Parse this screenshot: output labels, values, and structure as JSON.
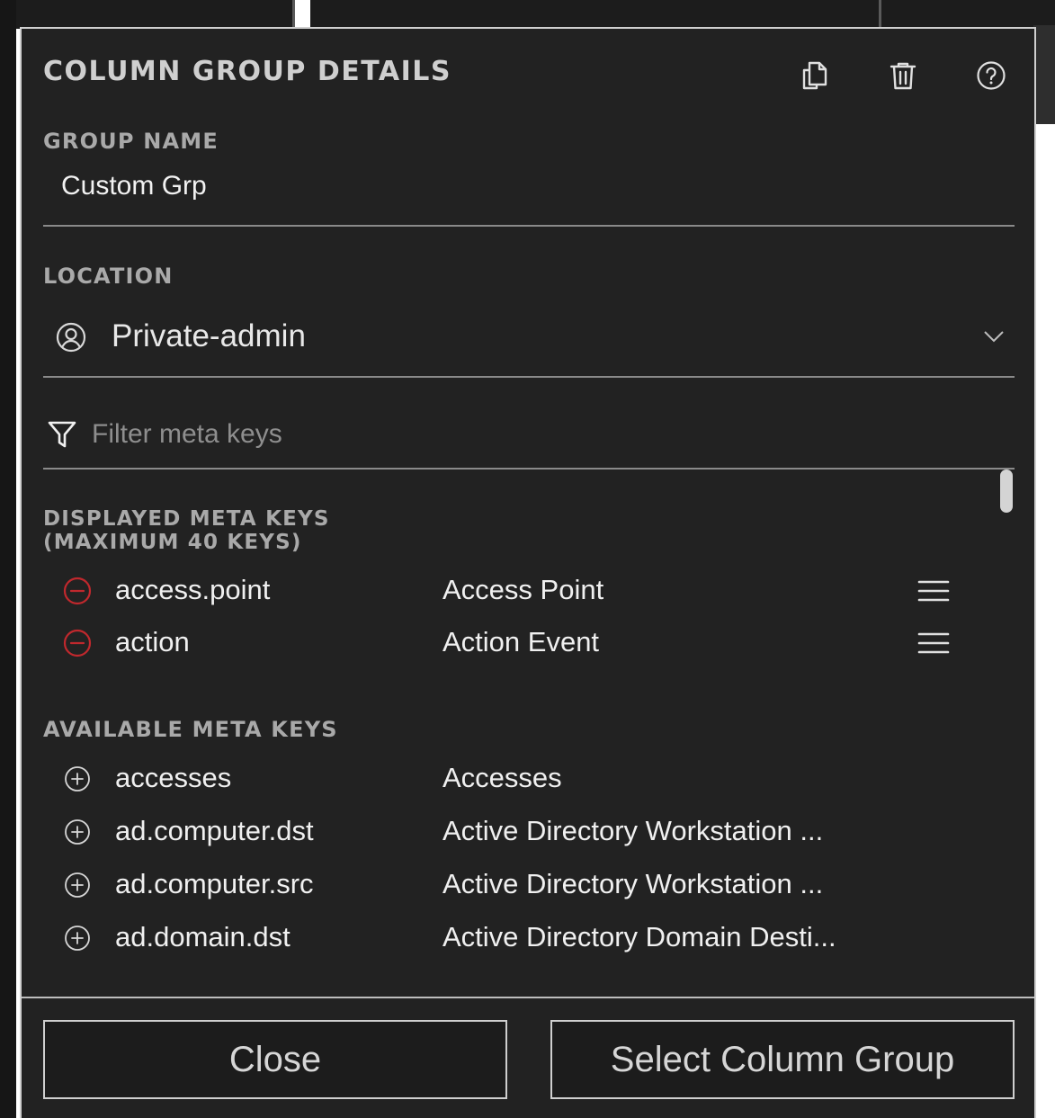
{
  "panel": {
    "title": "COLUMN GROUP DETAILS",
    "header_icons": [
      "copy-icon",
      "trash-icon",
      "help-icon"
    ]
  },
  "group_name": {
    "label": "GROUP NAME",
    "value": "Custom Grp"
  },
  "location": {
    "label": "LOCATION",
    "value": "Private-admin",
    "icon": "user-circle-icon"
  },
  "filter": {
    "placeholder": "Filter meta keys",
    "icon": "filter-icon"
  },
  "displayed": {
    "heading_line1": "DISPLAYED META KEYS",
    "heading_line2": "(MAXIMUM 40 KEYS)",
    "items": [
      {
        "key": "access.point",
        "description": "Access Point"
      },
      {
        "key": "action",
        "description": "Action Event"
      }
    ]
  },
  "available": {
    "heading": "AVAILABLE META KEYS",
    "items": [
      {
        "key": "accesses",
        "description": "Accesses"
      },
      {
        "key": "ad.computer.dst",
        "description": "Active Directory Workstation ..."
      },
      {
        "key": "ad.computer.src",
        "description": "Active Directory Workstation ..."
      },
      {
        "key": "ad.domain.dst",
        "description": "Active Directory Domain Desti..."
      }
    ]
  },
  "footer": {
    "close_label": "Close",
    "select_label": "Select Column Group"
  },
  "colors": {
    "panel_bg": "#222222",
    "remove_icon": "#c0282d",
    "text": "#f0f0f0",
    "label": "#a9a9a9"
  }
}
